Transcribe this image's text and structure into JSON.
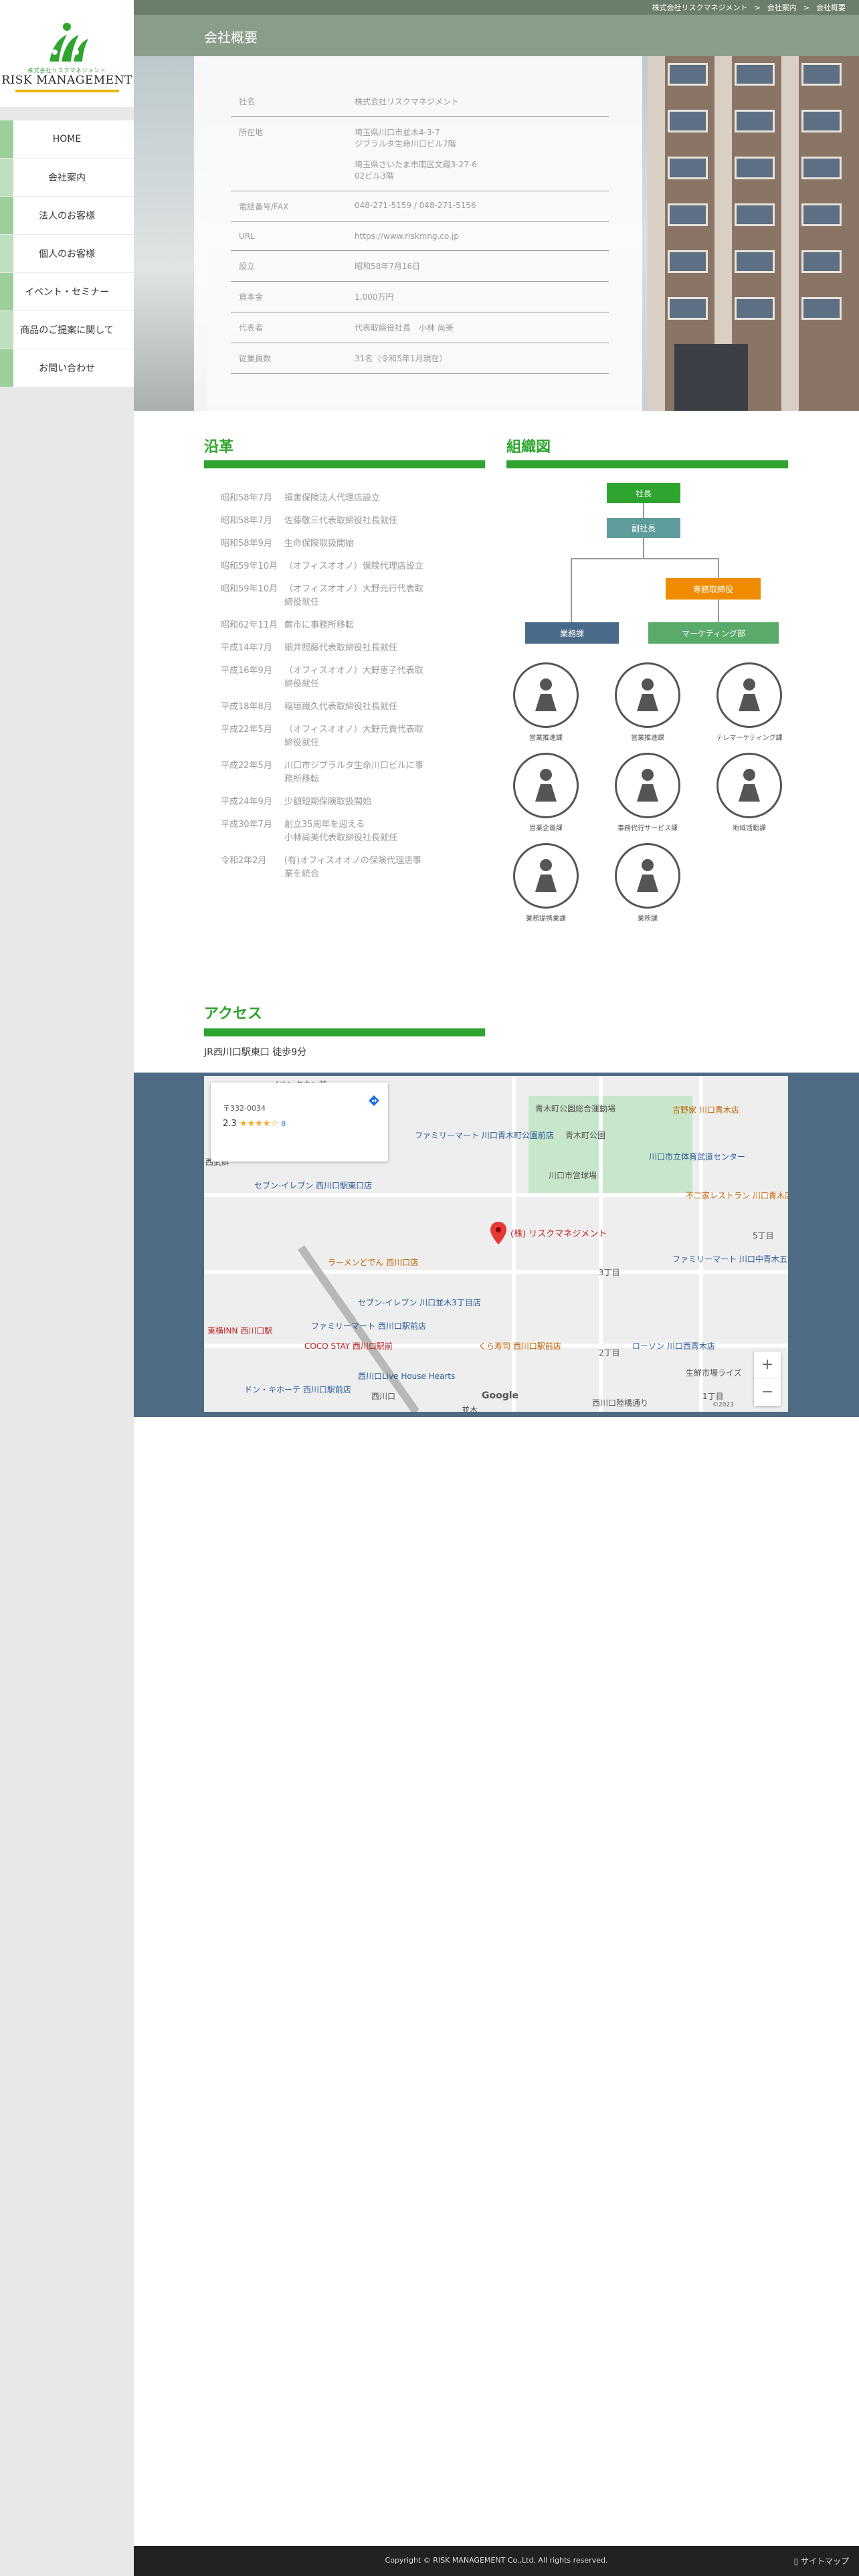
{
  "logo": {
    "sub": "株式会社リスクマネジメント",
    "text": "RISK MANAGEMENT"
  },
  "nav": [
    "HOME",
    "会社案内",
    "法人のお客様",
    "個人のお客様",
    "イベント・セミナー",
    "商品のご提案に関して",
    "お問い合わせ"
  ],
  "breadcrumb": [
    "株式会社リスクマネジメント",
    ">",
    "会社案内",
    ">",
    "会社概要"
  ],
  "page_title": "会社概要",
  "company_info": [
    {
      "k": "社名",
      "v": [
        "株式会社リスクマネジメント"
      ]
    },
    {
      "k": "所在地",
      "v": [
        "埼玉県川口市並木4-3-7",
        "ジブラルタ生命川口ビル7階",
        "",
        "埼玉県さいたま市南区文蔵3-27-6",
        "02ビル3階"
      ]
    },
    {
      "k": "電話番号/FAX",
      "v": [
        "048-271-5159 / 048-271-5156"
      ]
    },
    {
      "k": "URL",
      "v": [
        "https://www.riskmng.co.jp"
      ]
    },
    {
      "k": "設立",
      "v": [
        "昭和58年7月16日"
      ]
    },
    {
      "k": "資本金",
      "v": [
        "1,000万円"
      ]
    },
    {
      "k": "代表者",
      "v": [
        "代表取締役社長　小林 尚美"
      ]
    },
    {
      "k": "従業員数",
      "v": [
        "31名（令和5年1月現在）"
      ]
    }
  ],
  "history": {
    "title": "沿革",
    "rows": [
      {
        "d": "昭和58年7月",
        "t": [
          "損害保険法人代理店設立"
        ]
      },
      {
        "d": "昭和58年7月",
        "t": [
          "佐藤敬三代表取締役社長就任"
        ]
      },
      {
        "d": "昭和58年9月",
        "t": [
          "生命保険取扱開始"
        ]
      },
      {
        "d": "昭和59年10月",
        "t": [
          "（オフィスオオノ）保険代理店設立"
        ]
      },
      {
        "d": "昭和59年10月",
        "t": [
          "（オフィスオオノ）大野元行代表取",
          "締役就任"
        ]
      },
      {
        "d": "昭和62年11月",
        "t": [
          "蕨市に事務所移転"
        ]
      },
      {
        "d": "平成14年7月",
        "t": [
          "細井照藤代表取締役社長就任"
        ]
      },
      {
        "d": "平成16年9月",
        "t": [
          "（オフィスオオノ）大野恵子代表取",
          "締役就任"
        ]
      },
      {
        "d": "平成18年8月",
        "t": [
          "稲垣鐵久代表取締役社長就任"
        ]
      },
      {
        "d": "平成22年5月",
        "t": [
          "（オフィスオオノ）大野元貴代表取",
          "締役就任"
        ]
      },
      {
        "d": "平成22年5月",
        "t": [
          "川口市ジブラルタ生命川口ビルに事",
          "務所移転"
        ]
      },
      {
        "d": "平成24年9月",
        "t": [
          "少額短期保険取扱開始"
        ]
      },
      {
        "d": "平成30年7月",
        "t": [
          "創立35周年を迎える",
          "小林尚美代表取締役社長就任"
        ]
      },
      {
        "d": "令和2年2月",
        "t": [
          "(有)オフィスオオノの保険代理店事",
          "業を統合"
        ]
      }
    ]
  },
  "org": {
    "title": "組織図",
    "president": "社長",
    "vice": "副社長",
    "exec": "専務取締役",
    "ops": "業務課",
    "marketing": "マーケティング部",
    "units": [
      "営業推進課",
      "営業推進課",
      "テレマーケティング課",
      "営業企画課",
      "事務代行サービス課",
      "地域活動課",
      "業務提携業課",
      "業務課"
    ]
  },
  "access": {
    "title": "アクセス",
    "line": "JR西川口駅東口 徒歩9分",
    "map": {
      "marker": "(株) リスクマネジメント",
      "card_postal": "〒332-0034",
      "card_rating": "2.3",
      "card_stars": "★★★★☆",
      "card_reviews": "8",
      "google": "Google",
      "attribution": "©2023",
      "zoom_in": "+",
      "zoom_out": "−",
      "labels": [
        "イオンタウン前",
        "青木町公園総合運動場",
        "青木町公園",
        "川口市立体育武道センター",
        "吉野家 川口青木店",
        "ファミリーマート 川口青木町公園前店",
        "川口市営球場",
        "不二家レストラン 川口青木店",
        "セブン-イレブン 西川口駅東口店",
        "ラーメンどでん 西川口店",
        "セブン-イレブン 川口並木3丁目店",
        "ファミリーマート 西川口駅前店",
        "くら寿司 西川口駅前店",
        "COCO STAY 西川口駅前",
        "東横INN 西川口駅",
        "西川口Live House Hearts",
        "ドン・キホーテ 西川口駅前店",
        "ローソン 川口西青木店",
        "ファミリーマート 川口中青木五丁目店",
        "生鮮市場ライズ",
        "西川口陸橋通り",
        "5丁目",
        "3丁目",
        "2丁目",
        "並木",
        "1丁目",
        "西武鮮",
        "西川口"
      ]
    }
  },
  "footer": {
    "copyright": "Copyright © RISK MANAGEMENT Co.,Ltd. All rights reserved.",
    "sitemap": "サイトマップ"
  }
}
